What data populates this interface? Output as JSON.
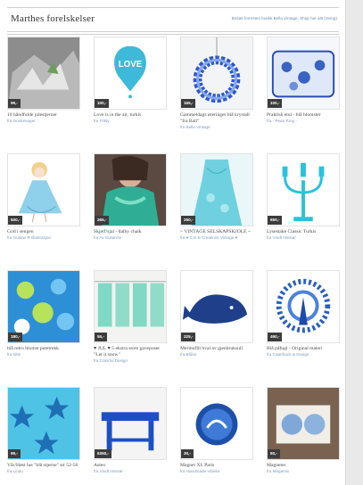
{
  "header": {
    "title": "Marthes forelskelser",
    "subtitle": "Besøk forresten butikk Bella Vintage. Shop her alt! (Sving)"
  },
  "items": [
    {
      "price": "99,-",
      "title": "10 håndfulde julestjerner",
      "shop": "fra smukesager",
      "image": "paper-stars"
    },
    {
      "price": "100,-",
      "title": "Love is in the air, turkis",
      "shop": "fra Frikly",
      "image": "love-balloon"
    },
    {
      "price": "165,-",
      "title": "Gammeldags øreringer blå krystall \"fra Bali\"",
      "shop": "fra Bella Vintage",
      "image": "blue-wreath"
    },
    {
      "price": "100,-",
      "title": "Praktisk etui - blå blomster",
      "shop": "fra - Peas Tong -",
      "image": "floral-pouch"
    },
    {
      "price": "500,-",
      "title": "God i sengen",
      "shop": "fra Gustav R Illustrasjon",
      "image": "girl-illustration"
    },
    {
      "price": "265,-",
      "title": "Skjerf/sjal - dalby chalk",
      "shop": "fra Av Susanne",
      "image": "scarf-woman"
    },
    {
      "price": "250,-",
      "title": "~ VINTAGE SELSKAPSKJOLE ~",
      "shop": "fra ♥ C.E.S Creations Vintage ♥",
      "image": "vintage-dress"
    },
    {
      "price": "650,-",
      "title": "Lysestake Classic Turkis",
      "shop": "fra Vindt Interiør",
      "image": "candelabra"
    },
    {
      "price": "180,-",
      "title": "blå retro blomst putetrekk",
      "shop": "fra hitle",
      "image": "retro-pillow"
    },
    {
      "price": "55,-",
      "title": "♥ JUL ♥ 5 ekstra store gaveposer \"Let it snow\"",
      "shop": "fra Colorful Design",
      "image": "gift-bags"
    },
    {
      "price": "225,-",
      "title": "Merinofilt hval av gjenbruksull",
      "shop": "fra Blåse",
      "image": "felt-whale"
    },
    {
      "price": "490,-",
      "title": "Blå påfugl - Original maleri",
      "shop": "fra Caterbuck & Design",
      "image": "peacock-art"
    },
    {
      "price": "99,-",
      "title": "Vår/Høst lue \"blå stjerne\" str 52-56",
      "shop": "fra Lindo",
      "image": "star-hat"
    },
    {
      "price": "6350,-",
      "title": "Asteo",
      "shop": "fra Vindt Interiør",
      "image": "blue-table"
    },
    {
      "price": "30,-",
      "title": "Magnet XL Paris",
      "shop": "fra Handmade Vibeke",
      "image": "paris-magnet"
    },
    {
      "price": "60,-",
      "title": "Magneter",
      "shop": "fra Megamix",
      "image": "magnets-box"
    }
  ]
}
